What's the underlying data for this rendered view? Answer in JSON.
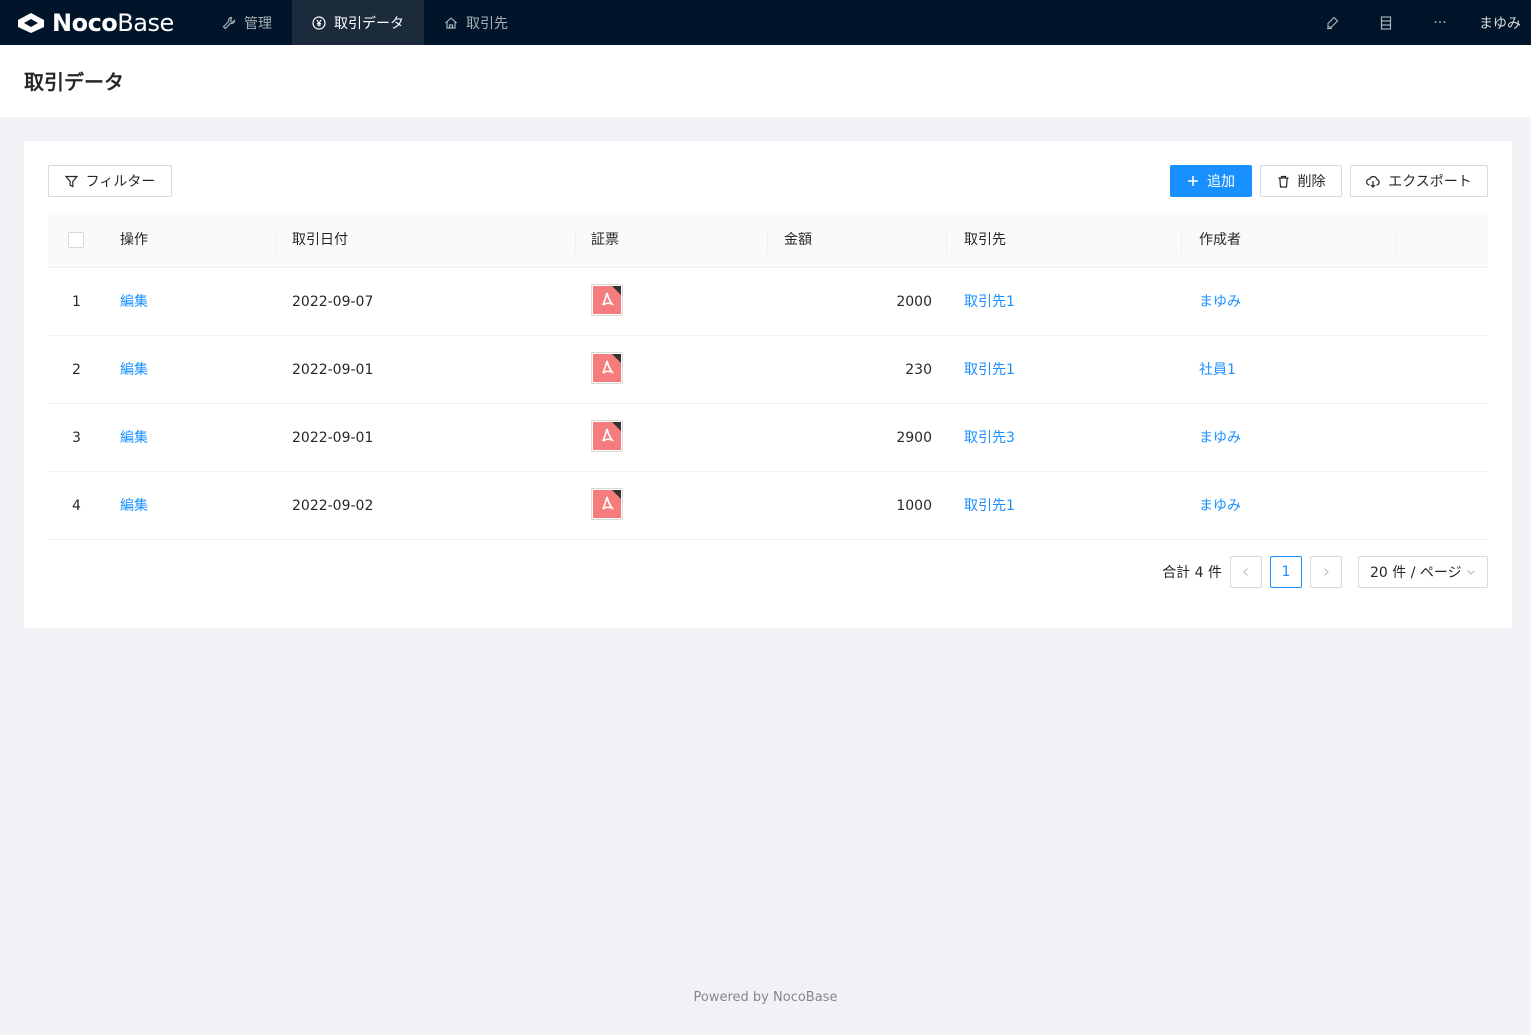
{
  "header": {
    "logo": {
      "bold": "Noco",
      "light": "Base"
    },
    "nav": [
      {
        "label": "管理",
        "icon": "wrench-icon"
      },
      {
        "label": "取引データ",
        "icon": "yen-circle-icon"
      },
      {
        "label": "取引先",
        "icon": "home-icon"
      }
    ],
    "right_icons": [
      "highlight-icon",
      "database-icon",
      "more-icon"
    ],
    "more_glyph": "···",
    "user": "まゆみ"
  },
  "page": {
    "title": "取引データ"
  },
  "toolbar": {
    "filter_label": "フィルター",
    "add_label": "追加",
    "delete_label": "削除",
    "export_label": "エクスポート"
  },
  "table": {
    "columns": [
      "操作",
      "取引日付",
      "証票",
      "金額",
      "取引先",
      "作成者"
    ],
    "rows": [
      {
        "index": "1",
        "action": "編集",
        "date": "2022-09-07",
        "voucher": "pdf-file-icon",
        "amount": "2000",
        "partner": "取引先1",
        "creator": "まゆみ"
      },
      {
        "index": "2",
        "action": "編集",
        "date": "2022-09-01",
        "voucher": "pdf-file-icon",
        "amount": "230",
        "partner": "取引先1",
        "creator": "社員1"
      },
      {
        "index": "3",
        "action": "編集",
        "date": "2022-09-01",
        "voucher": "pdf-file-icon",
        "amount": "2900",
        "partner": "取引先3",
        "creator": "まゆみ"
      },
      {
        "index": "4",
        "action": "編集",
        "date": "2022-09-02",
        "voucher": "pdf-file-icon",
        "amount": "1000",
        "partner": "取引先1",
        "creator": "まゆみ"
      }
    ]
  },
  "pagination": {
    "total": "合計 4 件",
    "current": "1",
    "page_size": "20 件 / ページ"
  },
  "footer": {
    "text": "Powered by NocoBase"
  },
  "colors": {
    "primary": "#1890ff",
    "topbar": "#001529",
    "pdf": "#f47c7c"
  }
}
